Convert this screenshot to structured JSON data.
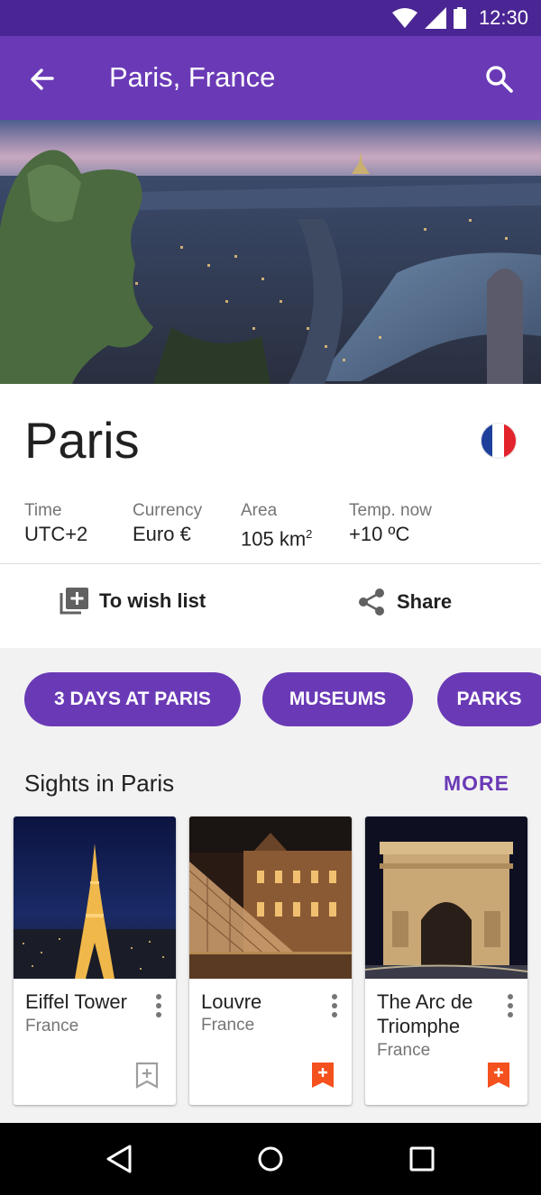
{
  "status_bar": {
    "time": "12:30"
  },
  "app_bar": {
    "title": "Paris, France",
    "back_icon": "arrow-back-icon",
    "search_icon": "search-icon",
    "background": "#6a3ab6"
  },
  "city": {
    "name": "Paris",
    "flag_icon": "france-flag-icon",
    "facts": [
      {
        "label": "Time",
        "value": "UTC+2"
      },
      {
        "label": "Currency",
        "value": "Euro €"
      },
      {
        "label": "Area",
        "value": "105 km",
        "sup": "2"
      },
      {
        "label": "Temp. now",
        "value": "+10 ºC"
      }
    ]
  },
  "actions": {
    "wish_list": "To wish list",
    "share": "Share"
  },
  "chips": [
    "3 DAYS AT PARIS",
    "MUSEUMS",
    "PARKS"
  ],
  "sights": {
    "title": "Sights in Paris",
    "more": "MORE",
    "items": [
      {
        "name": "Eiffel Tower",
        "country": "France",
        "saved": false
      },
      {
        "name": "Louvre",
        "country": "France",
        "saved": true
      },
      {
        "name": "The Arc de Triomphe",
        "country": "France",
        "saved": true
      }
    ]
  },
  "colors": {
    "accent": "#6a3ab6",
    "status": "#4a2594",
    "bookmark_active": "#f4511e",
    "bookmark_inactive": "#9e9e9e"
  }
}
